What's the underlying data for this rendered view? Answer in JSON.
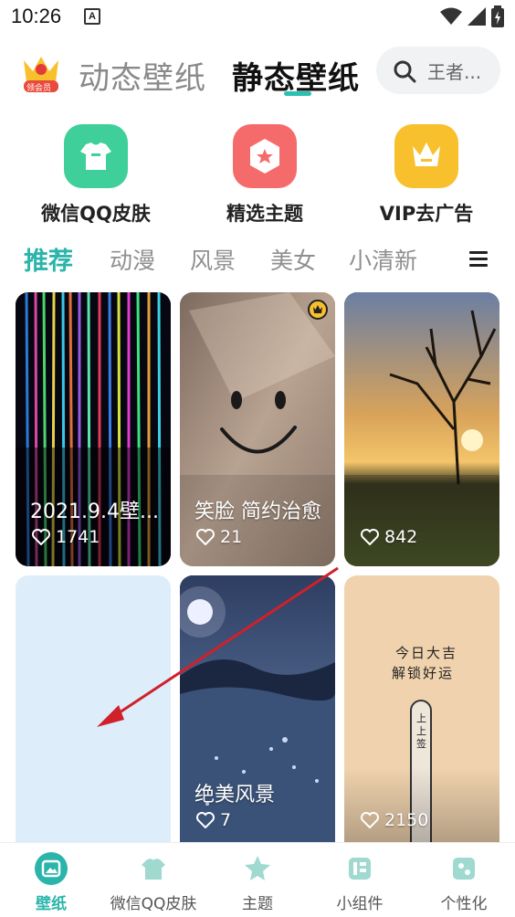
{
  "status": {
    "time": "10:26",
    "notif_letter": "A"
  },
  "header": {
    "vip_badge": "领会员",
    "tab_dynamic": "动态壁纸",
    "tab_static": "静态壁纸",
    "search_placeholder": "王者..."
  },
  "categories": [
    {
      "label": "微信QQ皮肤",
      "icon": "tshirt-icon",
      "color": "#3ecf9a"
    },
    {
      "label": "精选主题",
      "icon": "hexagon-star-icon",
      "color": "#f56b6b"
    },
    {
      "label": "VIP去广告",
      "icon": "crown-icon",
      "color": "#f7c02c"
    }
  ],
  "subtabs": [
    "推荐",
    "动漫",
    "风景",
    "美女",
    "小清新"
  ],
  "cards": [
    {
      "title": "2021.9.4壁...",
      "likes": "1741"
    },
    {
      "title": "笑脸 简约治愈",
      "likes": "21"
    },
    {
      "title": "",
      "likes": "842"
    },
    {
      "title": "",
      "likes": ""
    },
    {
      "title": "绝美风景",
      "likes": "7"
    },
    {
      "title": "",
      "likes": "2150"
    }
  ],
  "card6_text": {
    "line1": "今日大吉",
    "line2": "解锁好运",
    "stick": "上上签"
  },
  "bottom_nav": [
    "壁纸",
    "微信QQ皮肤",
    "主题",
    "小组件",
    "个性化"
  ],
  "colors": {
    "accent": "#2bb5aa",
    "arrow": "#d0202a"
  }
}
